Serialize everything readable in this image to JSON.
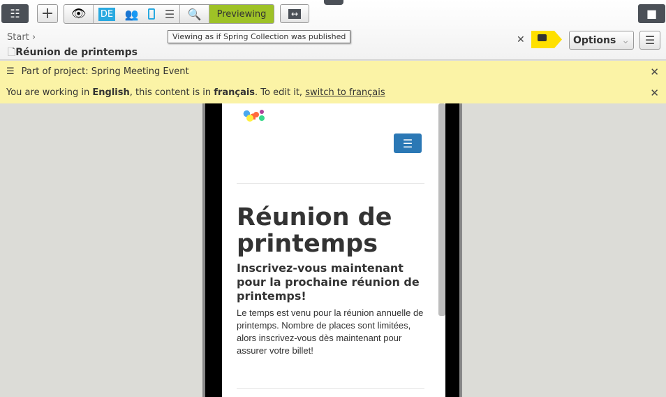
{
  "toolbar": {
    "lang": "DE",
    "previewing": "Previewing",
    "tooltip": "Viewing as if Spring Collection was published",
    "options": "Options"
  },
  "breadcrumb": {
    "start": "Start",
    "title": "Réunion de printemps"
  },
  "banners": {
    "project": "Part of project: Spring Meeting Event",
    "lang_pre": "You are working in ",
    "lang_en": "English",
    "lang_mid": ", this content is in ",
    "lang_fr": "français",
    "lang_post": ". To edit it, ",
    "switch_link": "switch to français"
  },
  "content": {
    "heading": "Réunion de printemps",
    "subheading": "Inscrivez-vous maintenant pour la prochaine réunion de printemps!",
    "body": "Le temps est venu pour la réunion annuelle de printemps. Nombre de places sont limitées, alors inscrivez-vous dès maintenant pour assurer votre billet!"
  },
  "colors": {
    "accent": "#9ec226",
    "banner": "#fbf3a6",
    "lang": "#29a9e0",
    "comment": "#ffe000",
    "menu": "#2b78b5"
  }
}
